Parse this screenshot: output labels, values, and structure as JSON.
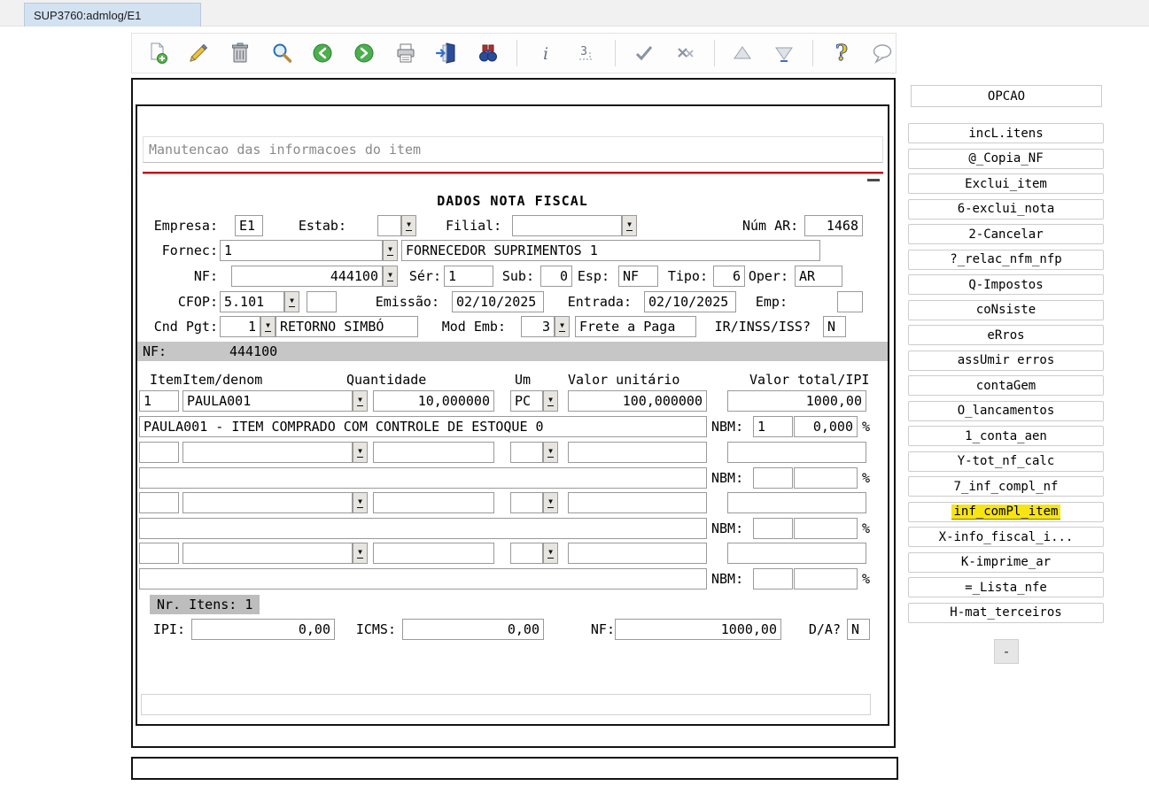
{
  "window": {
    "tab_title": "SUP3760:admlog/E1"
  },
  "toolbar": {
    "icons": [
      "new-record",
      "edit-record",
      "delete-record",
      "search",
      "previous-record",
      "next-record",
      "print",
      "exit",
      "find",
      "info",
      "row-number",
      "confirm",
      "cancel",
      "navigate-up",
      "navigate-down",
      "help",
      "comment"
    ]
  },
  "form": {
    "header": "Manutencao das informacoes do item",
    "section_title": "DADOS NOTA FISCAL",
    "labels": {
      "empresa": "Empresa:",
      "estab": "Estab:",
      "filial": "Filial:",
      "num_ar": "Núm AR:",
      "fornec": "Fornec:",
      "nf": "NF:",
      "ser": "Sér:",
      "sub": "Sub:",
      "esp": "Esp:",
      "tipo": "Tipo:",
      "oper": "Oper:",
      "cfop": "CFOP:",
      "emissao": "Emissão:",
      "entrada": "Entrada:",
      "emp": "Emp:",
      "cnd_pgt": "Cnd Pgt:",
      "mod_emb": "Mod Emb:",
      "ir_inss_iss": "IR/INSS/ISS?",
      "nf_bar": "NF:",
      "nbm": "NBM:",
      "percent": "%",
      "nr_itens": "Nr. Itens: 1",
      "ipi": "IPI:",
      "icms": "ICMS:",
      "nf_total": "NF:",
      "da": "D/A?"
    },
    "values": {
      "empresa": "E1",
      "estab": "",
      "filial": "",
      "num_ar": "1468",
      "fornec_code": "1",
      "fornec_name": "FORNECEDOR SUPRIMENTOS 1",
      "nf": "444100",
      "ser": "1",
      "sub": "0",
      "esp": "NF",
      "tipo": "6",
      "oper": "AR",
      "cfop": "5.101",
      "cfop_aux": "",
      "emissao": "02/10/2025",
      "entrada": "02/10/2025",
      "emp": "",
      "cnd_pgt_code": "1",
      "cnd_pgt_desc": "RETORNO SIMBÓ",
      "mod_emb_code": "3",
      "mod_emb_desc": "Frete a Paga",
      "ir_inss_iss": "N",
      "nf_bar_value": "444100",
      "ipi_total": "0,00",
      "icms_total": "0,00",
      "nf_total": "1000,00",
      "da": "N"
    }
  },
  "items": {
    "headers": {
      "item": "Item",
      "denom": "Item/denom",
      "qty": "Quantidade",
      "um": "Um",
      "unit": "Valor unitário",
      "total": "Valor total/IPI"
    },
    "rows": [
      {
        "item": "1",
        "denom": "PAULA001",
        "qty": "10,000000",
        "um": "PC",
        "unit": "100,000000",
        "total": "1000,00",
        "desc": "PAULA001 - ITEM COMPRADO COM CONTROLE DE ESTOQUE 0",
        "nbm": "1",
        "ipi_pct": "0,000"
      },
      {
        "item": "",
        "denom": "",
        "qty": "",
        "um": "",
        "unit": "",
        "total": "",
        "desc": "",
        "nbm": "",
        "ipi_pct": ""
      },
      {
        "item": "",
        "denom": "",
        "qty": "",
        "um": "",
        "unit": "",
        "total": "",
        "desc": "",
        "nbm": "",
        "ipi_pct": ""
      },
      {
        "item": "",
        "denom": "",
        "qty": "",
        "um": "",
        "unit": "",
        "total": "",
        "desc": "",
        "nbm": "",
        "ipi_pct": ""
      }
    ]
  },
  "sidebar": {
    "title": "OPCAO",
    "buttons": [
      {
        "label": "incL.itens"
      },
      {
        "label": "@_Copia_NF"
      },
      {
        "label": "Exclui_item"
      },
      {
        "label": "6-exclui_nota"
      },
      {
        "label": "2-Cancelar"
      },
      {
        "label": "?_relac_nfm_nfp"
      },
      {
        "label": "Q-Impostos"
      },
      {
        "label": "coNsiste"
      },
      {
        "label": "eRros"
      },
      {
        "label": "assUmir erros"
      },
      {
        "label": "contaGem"
      },
      {
        "label": "O_lancamentos"
      },
      {
        "label": "1_conta_aen"
      },
      {
        "label": "Y-tot_nf_calc"
      },
      {
        "label": "7_inf_compl_nf"
      },
      {
        "label": "inf_comPl_item",
        "highlighted": true
      },
      {
        "label": "X-info_fiscal_i..."
      },
      {
        "label": "K-imprime_ar"
      },
      {
        "label": "=_Lista_nfe"
      },
      {
        "label": "H-mat_terceiros"
      }
    ],
    "collapse_label": "-",
    "highlight_color": "#f7e412"
  }
}
